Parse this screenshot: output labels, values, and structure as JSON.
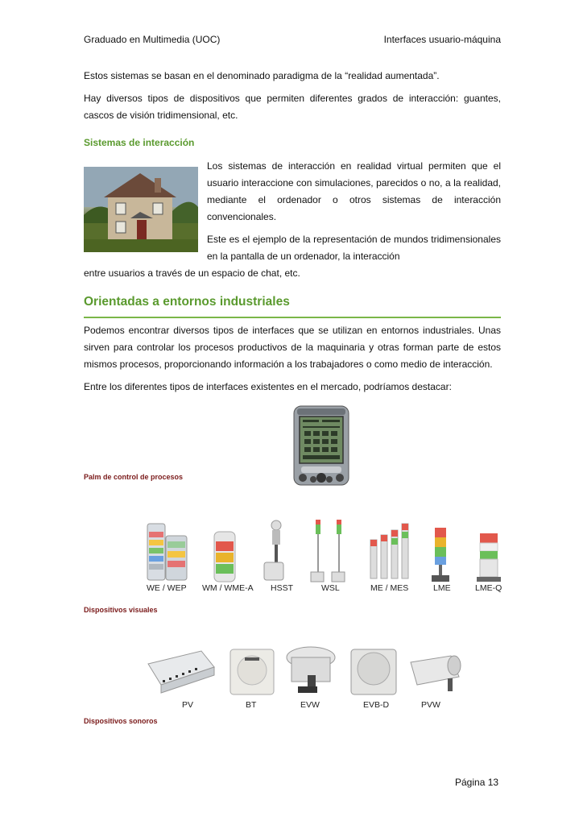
{
  "header": {
    "left": "Graduado en Multimedia (UOC)",
    "right": "Interfaces usuario-máquina"
  },
  "paragraphs": {
    "p1": "Estos sistemas se basan en el denominado paradigma de la “realidad aumentada”.",
    "p2": "Hay diversos tipos de dispositivos que permiten diferentes grados de interacción: guantes, cascos de visión tridimensional, etc."
  },
  "interaction": {
    "heading": "Sistemas de interacción",
    "text1": "Los sistemas de interacción en realidad virtual permiten que el usuario interaccione con simulaciones, parecidos o no, a la realidad, mediante el ordenador o otros sistemas de interacción convencionales.",
    "text2_a": "Este es el ejemplo de la representación de mundos tridimensionales en la pantalla de un ordenador, la interacción",
    "text2_b": "entre usuarios a través de un espacio de chat, etc."
  },
  "industrial": {
    "title": "Orientadas a entornos industriales",
    "p1": "Podemos encontrar diversos tipos de interfaces que se utilizan en entornos industriales. Unas sirven para controlar los procesos productivos de la maquinaria y otras forman parte de estos mismos procesos, proporcionando información a los trabajadores o como medio de interacción.",
    "p2": "Entre los diferentes tipos de interfaces existentes en el mercado, podríamos destacar:"
  },
  "palm": {
    "caption": "Palm de control de procesos"
  },
  "visual_devices": {
    "caption": "Dispositivos visuales",
    "labels": [
      "WE / WEP",
      "WM / WME-A",
      "HSST",
      "WSL",
      "ME / MES",
      "LME",
      "LME-Q"
    ]
  },
  "sound_devices": {
    "caption": "Dispositivos sonoros",
    "labels": [
      "PV",
      "BT",
      "EVW",
      "EVB-D",
      "PVW"
    ]
  },
  "footer": {
    "page": "Página 13"
  }
}
